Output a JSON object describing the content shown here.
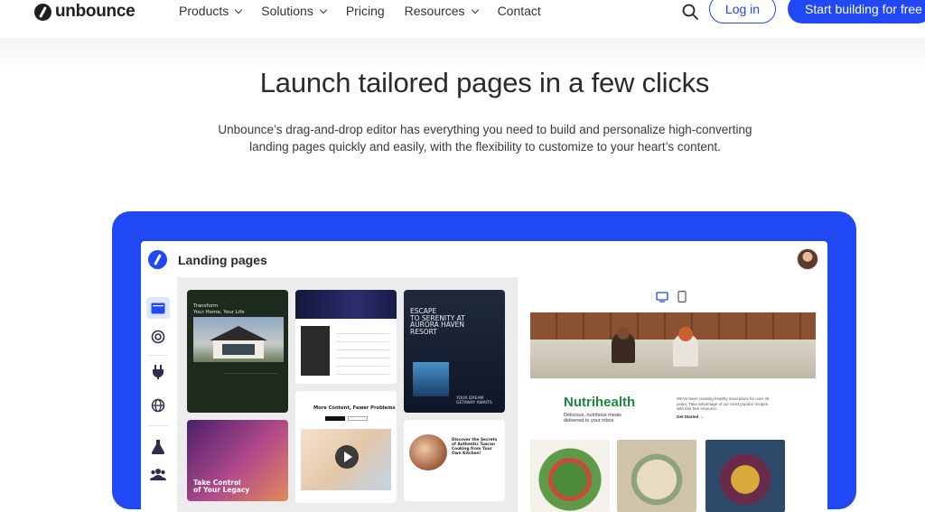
{
  "nav": {
    "brand": "unbounce",
    "items": [
      {
        "label": "Products",
        "dropdown": true
      },
      {
        "label": "Solutions",
        "dropdown": true
      },
      {
        "label": "Pricing",
        "dropdown": false
      },
      {
        "label": "Resources",
        "dropdown": true
      },
      {
        "label": "Contact",
        "dropdown": false
      }
    ],
    "login_label": "Log in",
    "cta_label": "Start building for free",
    "search_icon": "search-icon"
  },
  "hero": {
    "title": "Launch tailored pages in a few clicks",
    "subtitle": "Unbounce’s drag-and-drop editor has everything you need to build and personalize high-converting landing pages quickly and easily, with the flexibility to customize to your heart’s content."
  },
  "app": {
    "title": "Landing pages",
    "sidebar_icons": [
      "pages-icon",
      "target-icon",
      "plug-icon",
      "globe-icon",
      "flask-icon",
      "users-icon"
    ],
    "templates": [
      {
        "heading": "Transform\nYour Home, Your Life"
      },
      {
        "heading": ""
      },
      {
        "heading": "ESCAPE\nTO SERENITY AT\nAURORA HAVEN\nRESORT",
        "sub": "YOUR DREAM\nGETAWAY AWAITS"
      },
      {
        "heading": "Take Control\nof Your Legacy"
      },
      {
        "heading": "More Content, Fewer Problems"
      },
      {
        "heading": "Discover the Secrets\nof Authentic Tuscan\nCooking from Your\nOwn Kitchen!"
      }
    ],
    "preview": {
      "device_icons": [
        "desktop-icon",
        "mobile-icon"
      ],
      "brand": "Nutrihealth",
      "tagline": "Delicious, nutritious meals\ndelivered to your inbox",
      "copy": "We've been creating healthy meal plans for over 40 years. Take advantage of our most popular recipes with this free resource.",
      "cta": "Get Started →"
    }
  },
  "colors": {
    "accent": "#2148f5",
    "brand_green": "#1a8a3a"
  }
}
